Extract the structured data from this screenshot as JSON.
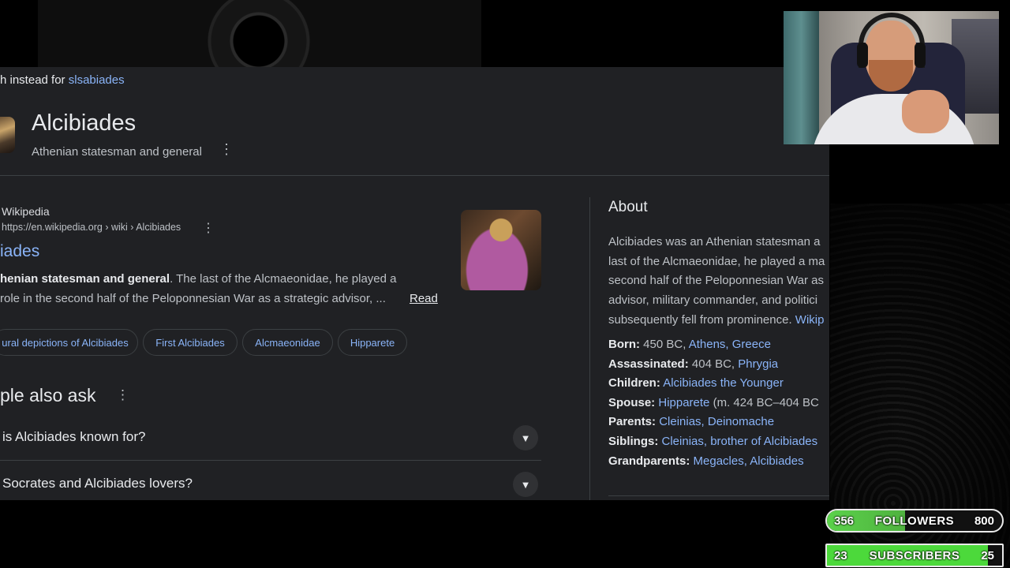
{
  "search": {
    "spell_prefix": "h instead for",
    "spell_link": "slsabiades"
  },
  "knowledge_panel": {
    "title": "Alcibiades",
    "subtitle": "Athenian statesman and general"
  },
  "result": {
    "source_name": "Wikipedia",
    "url": "https://en.wikipedia.org › wiki › Alcibiades",
    "title": "iades",
    "snippet_bold": "henian statesman and general",
    "snippet_line1": ". The last of the Alcmaeonidae, he played a",
    "snippet_line2": "role in the second half of the Peloponnesian War as a strategic advisor, ...",
    "read_link": "Read"
  },
  "chips": [
    "ural depictions of Alcibiades",
    "First Alcibiades",
    "Alcmaeonidae",
    "Hipparete"
  ],
  "people_also_ask": {
    "title": "ple also ask",
    "questions": [
      "is Alcibiades known for?",
      "Socrates and Alcibiades lovers?"
    ]
  },
  "about": {
    "heading": "About",
    "lines": [
      "Alcibiades was an Athenian statesman a",
      "last of the Alcmaeonidae, he played a ma",
      "second half of the Peloponnesian War as",
      "advisor, military commander, and politici",
      "subsequently fell from prominence."
    ],
    "wiki_link": "Wikip",
    "facts": [
      {
        "key": "Born:",
        "plain": "450 BC, ",
        "links": "Athens, Greece",
        "after": ""
      },
      {
        "key": "Assassinated:",
        "plain": "404 BC, ",
        "links": "Phrygia",
        "after": ""
      },
      {
        "key": "Children:",
        "plain": "",
        "links": "Alcibiades the Younger",
        "after": ""
      },
      {
        "key": "Spouse:",
        "plain": "",
        "links": "Hipparete",
        "after": " (m. 424 BC–404 BC"
      },
      {
        "key": "Parents:",
        "plain": "",
        "links": "Cleinias, Deinomache",
        "after": ""
      },
      {
        "key": "Siblings:",
        "plain": "",
        "links": "Cleinias, brother of Alcibiades",
        "after": ""
      },
      {
        "key": "Grandparents:",
        "plain": "",
        "links": "Megacles, Alcibiades",
        "after": ""
      }
    ]
  },
  "goals": {
    "followers": {
      "current": "356",
      "label": "FOLLOWERS",
      "target": "800",
      "progress": 0.445
    },
    "subscribers": {
      "current": "23",
      "label": "SUBSCRIBERS",
      "target": "25",
      "progress": 0.92
    }
  },
  "colors": {
    "panel_bg": "#202124",
    "link": "#8ab4f8",
    "goal_fill": "#4cd93b"
  }
}
